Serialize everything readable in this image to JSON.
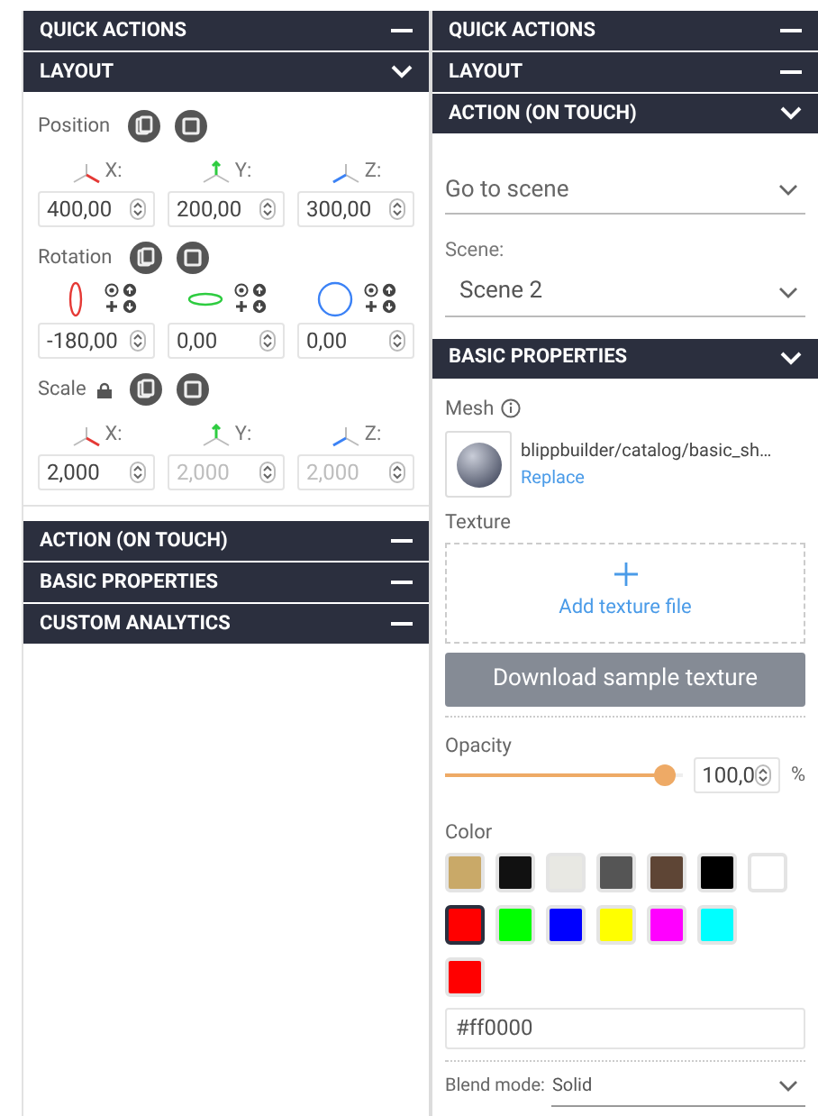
{
  "left": {
    "headers_top": [
      {
        "title": "QUICK ACTIONS",
        "expanded": false
      },
      {
        "title": "LAYOUT",
        "expanded": true
      }
    ],
    "groups": [
      {
        "kind": "position",
        "label": "Position",
        "axes": [
          {
            "label": "X:",
            "value": "400,00",
            "disabled": false
          },
          {
            "label": "Y:",
            "value": "200,00",
            "disabled": false
          },
          {
            "label": "Z:",
            "value": "300,00",
            "disabled": false
          }
        ]
      },
      {
        "kind": "rotation",
        "label": "Rotation",
        "axes": [
          {
            "value": "-180,00",
            "disabled": false
          },
          {
            "value": "0,00",
            "disabled": false
          },
          {
            "value": "0,00",
            "disabled": false
          }
        ]
      },
      {
        "kind": "scale",
        "label": "Scale",
        "locked": true,
        "axes": [
          {
            "label": "X:",
            "value": "2,000",
            "disabled": false
          },
          {
            "label": "Y:",
            "value": "2,000",
            "disabled": true
          },
          {
            "label": "Z:",
            "value": "2,000",
            "disabled": true
          }
        ]
      }
    ],
    "headers_bottom": [
      {
        "title": "ACTION (ON TOUCH)",
        "expanded": false
      },
      {
        "title": "BASIC PROPERTIES",
        "expanded": false
      },
      {
        "title": "CUSTOM ANALYTICS",
        "expanded": false
      }
    ]
  },
  "right": {
    "headers_top": [
      {
        "title": "QUICK ACTIONS",
        "expanded": false
      },
      {
        "title": "LAYOUT",
        "expanded": false
      },
      {
        "title": "ACTION (ON TOUCH)",
        "expanded": true
      }
    ],
    "action": {
      "value": "Go to scene",
      "scene_label": "Scene:",
      "scene_value": "Scene 2"
    },
    "basic_header": {
      "title": "BASIC PROPERTIES",
      "expanded": true
    },
    "mesh": {
      "label": "Mesh",
      "path": "blippbuilder/catalog/basic_sh…",
      "link": "Replace"
    },
    "texture": {
      "label": "Texture",
      "add_text": "Add texture file"
    },
    "download_button": "Download sample texture",
    "opacity": {
      "label": "Opacity",
      "level": 0.93,
      "value": "100,0",
      "unit": "%"
    },
    "color": {
      "label": "Color",
      "swatches": [
        {
          "color": "#c9a968",
          "selected": false
        },
        {
          "color": "#111111",
          "selected": false
        },
        {
          "color": "#e8e8e3",
          "selected": false
        },
        {
          "color": "#555555",
          "selected": false
        },
        {
          "color": "#5e4535",
          "selected": false
        },
        {
          "color": "#000000",
          "selected": false
        },
        {
          "color": "#ffffff",
          "selected": false
        },
        {
          "color": "#ff0000",
          "selected": true
        },
        {
          "color": "#00ff00",
          "selected": false
        },
        {
          "color": "#0000ff",
          "selected": false
        },
        {
          "color": "#ffff00",
          "selected": false
        },
        {
          "color": "#ff00ff",
          "selected": false
        },
        {
          "color": "#00ffff",
          "selected": false
        }
      ],
      "hex": "#ff0000"
    },
    "blend": {
      "label": "Blend mode:",
      "value": "Solid"
    }
  }
}
